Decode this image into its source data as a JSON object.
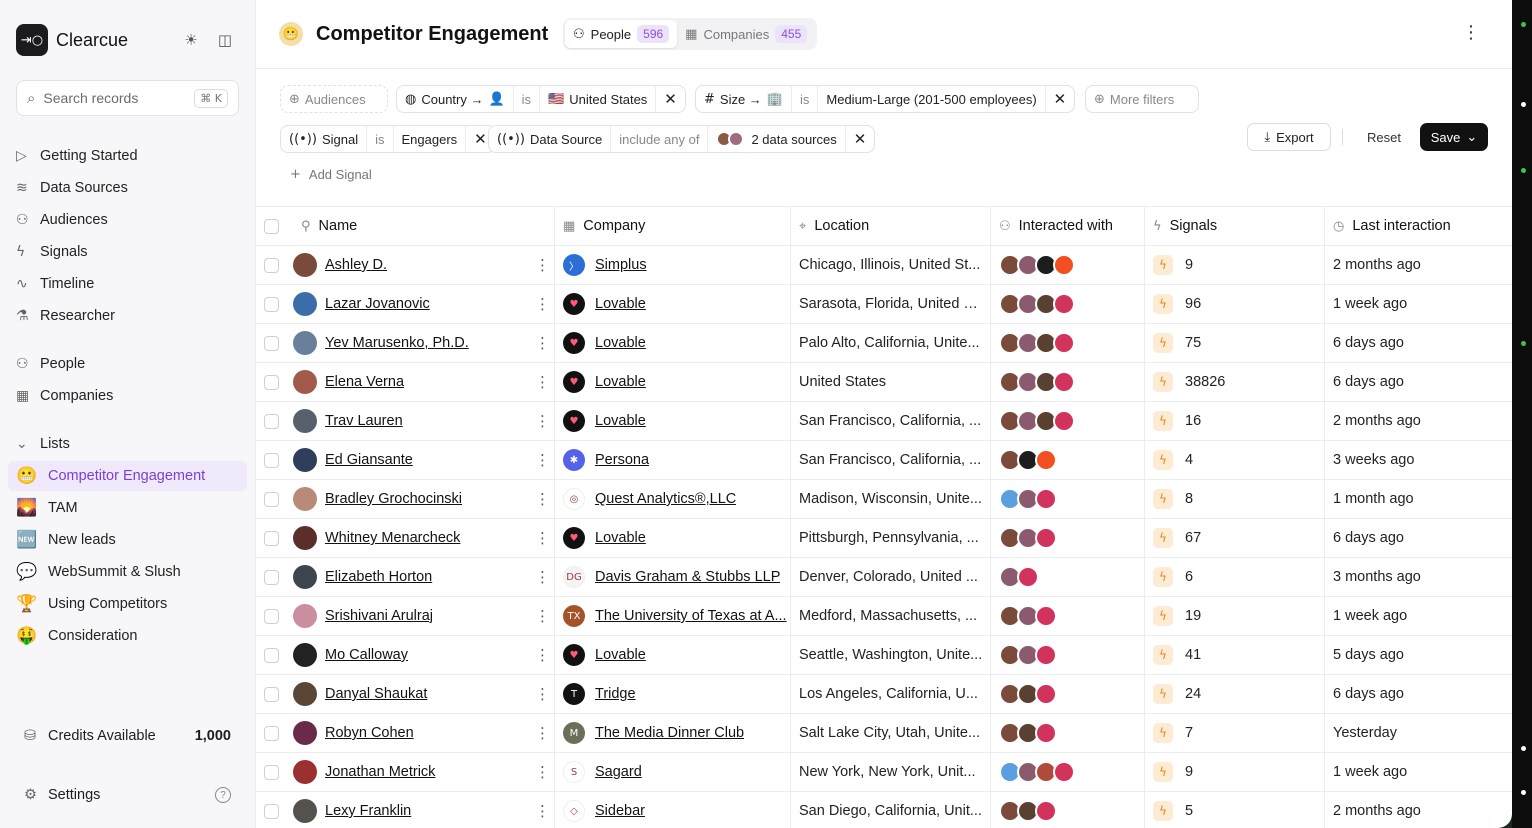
{
  "app": {
    "brand": "Clearcue",
    "logo_glyph": "⇥○"
  },
  "search": {
    "placeholder": "Search records",
    "shortcut": "⌘ K"
  },
  "nav_main": [
    {
      "label": "Getting Started",
      "icon": "play-circle-icon",
      "glyph": "▷"
    },
    {
      "label": "Data Sources",
      "icon": "database-icon",
      "glyph": "≋"
    },
    {
      "label": "Audiences",
      "icon": "users-icon",
      "glyph": "⚇"
    },
    {
      "label": "Signals",
      "icon": "zap-icon",
      "glyph": "ϟ"
    },
    {
      "label": "Timeline",
      "icon": "activity-icon",
      "glyph": "∿"
    },
    {
      "label": "Researcher",
      "icon": "flask-icon",
      "glyph": "⚗"
    }
  ],
  "nav_records": [
    {
      "label": "People",
      "icon": "people-icon",
      "glyph": "⚇"
    },
    {
      "label": "Companies",
      "icon": "building-icon",
      "glyph": "▦"
    }
  ],
  "lists": {
    "header": "Lists",
    "items": [
      {
        "label": "Competitor Engagement",
        "emoji": "😬",
        "active": true
      },
      {
        "label": "TAM",
        "emoji": "🌄",
        "active": false
      },
      {
        "label": "New leads",
        "emoji": "🆕",
        "active": false
      },
      {
        "label": "WebSummit & Slush",
        "emoji": "💬",
        "active": false
      },
      {
        "label": "Using Competitors",
        "emoji": "🏆",
        "active": false
      },
      {
        "label": "Consideration",
        "emoji": "🤑",
        "active": false
      }
    ]
  },
  "credits": {
    "label": "Credits Available",
    "value": "1,000"
  },
  "settings": {
    "label": "Settings"
  },
  "page": {
    "title": "Competitor Engagement",
    "title_emoji": "😬",
    "tabs": [
      {
        "label": "People",
        "count": "596",
        "active": true
      },
      {
        "label": "Companies",
        "count": "455",
        "active": false
      }
    ]
  },
  "filters": {
    "audiences": "Audiences",
    "country": {
      "field": "Country →",
      "op": "is",
      "value": "United States",
      "flag": "🇺🇸"
    },
    "size": {
      "field": "Size →",
      "op": "is",
      "value": "Medium-Large (201-500 employees)"
    },
    "more": "More filters",
    "signal": {
      "field": "Signal",
      "op": "is",
      "value": "Engagers"
    },
    "source": {
      "field": "Data Source",
      "op": "include any of",
      "value": "2 data sources"
    },
    "add_signal": "Add Signal"
  },
  "actions": {
    "export": "Export",
    "reset": "Reset",
    "save": "Save"
  },
  "columns": [
    "Name",
    "Company",
    "Location",
    "Interacted with",
    "Signals",
    "Last interaction"
  ],
  "accent": "#7a3fd6",
  "rows": [
    {
      "name": "Ashley D.",
      "company": "Simplus",
      "location": "Chicago, Illinois, United St...",
      "signals": "9",
      "last": "2 months ago"
    },
    {
      "name": "Lazar Jovanovic",
      "company": "Lovable",
      "location": "Sarasota, Florida, United S...",
      "signals": "96",
      "last": "1 week ago"
    },
    {
      "name": "Yev Marusenko, Ph.D.",
      "company": "Lovable",
      "location": "Palo Alto, California, Unite...",
      "signals": "75",
      "last": "6 days ago"
    },
    {
      "name": "Elena Verna",
      "company": "Lovable",
      "location": "United States",
      "signals": "38826",
      "last": "6 days ago"
    },
    {
      "name": "Trav Lauren",
      "company": "Lovable",
      "location": "San Francisco, California, ...",
      "signals": "16",
      "last": "2 months ago"
    },
    {
      "name": "Ed Giansante",
      "company": "Persona",
      "location": "San Francisco, California, ...",
      "signals": "4",
      "last": "3 weeks ago"
    },
    {
      "name": "Bradley Grochocinski",
      "company": "Quest Analytics®,LLC",
      "location": "Madison, Wisconsin, Unite...",
      "signals": "8",
      "last": "1 month ago"
    },
    {
      "name": "Whitney Menarcheck",
      "company": "Lovable",
      "location": "Pittsburgh, Pennsylvania, ...",
      "signals": "67",
      "last": "6 days ago"
    },
    {
      "name": "Elizabeth Horton",
      "company": "Davis Graham & Stubbs LLP",
      "location": "Denver, Colorado, United ...",
      "signals": "6",
      "last": "3 months ago"
    },
    {
      "name": "Srishivani Arulraj",
      "company": "The University of Texas at A...",
      "location": "Medford, Massachusetts, ...",
      "signals": "19",
      "last": "1 week ago"
    },
    {
      "name": "Mo Calloway",
      "company": "Lovable",
      "location": "Seattle, Washington, Unite...",
      "signals": "41",
      "last": "5 days ago"
    },
    {
      "name": "Danyal Shaukat",
      "company": "Tridge",
      "location": "Los Angeles, California, U...",
      "signals": "24",
      "last": "6 days ago"
    },
    {
      "name": "Robyn Cohen",
      "company": "The Media Dinner Club",
      "location": "Salt Lake City, Utah, Unite...",
      "signals": "7",
      "last": "Yesterday"
    },
    {
      "name": "Jonathan Metrick",
      "company": "Sagard",
      "location": "New York, New York, Unit...",
      "signals": "9",
      "last": "1 week ago"
    },
    {
      "name": "Lexy Franklin",
      "company": "Sidebar",
      "location": "San Diego, California, Unit...",
      "signals": "5",
      "last": "2 months ago"
    }
  ]
}
